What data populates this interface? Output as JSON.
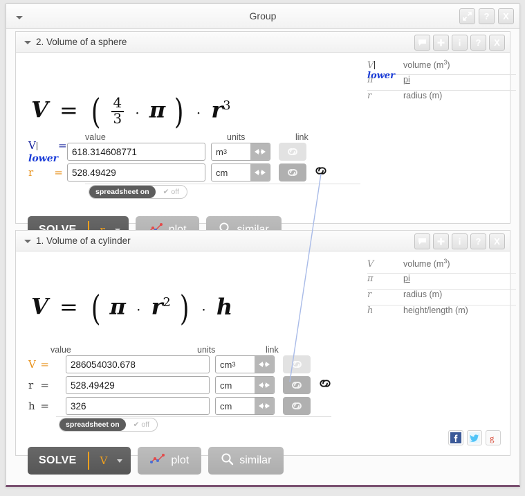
{
  "window": {
    "title": "Group",
    "buttons": [
      {
        "name": "expand-button",
        "icon": "expand-icon"
      },
      {
        "name": "help-button",
        "icon": "question-icon",
        "label": "?"
      },
      {
        "name": "close-button",
        "icon": "close-icon",
        "label": "X"
      }
    ]
  },
  "panel_icons": [
    "comment-icon",
    "plus-icon",
    "info-icon",
    "question-icon",
    "close-icon"
  ],
  "columns": {
    "value": "value",
    "units": "units",
    "link": "link"
  },
  "spreadsheet": {
    "on": "spreadsheet on",
    "off": "off",
    "check": "✔"
  },
  "panels": [
    {
      "id": "sphere",
      "title": "2. Volume of a sphere",
      "equation": {
        "lhs": "V",
        "eq": "=",
        "numerator": "4",
        "denominator": "3",
        "pi": "π",
        "dot": "·",
        "rvar": "r",
        "exponent": "3"
      },
      "variables": [
        {
          "symbol": "V",
          "sub": "lower",
          "editing": true,
          "desc": "volume (m",
          "sup": "3",
          "desc_tail": ")",
          "link": false
        },
        {
          "symbol": "π",
          "desc": "pi",
          "link": true
        },
        {
          "symbol": "r",
          "desc": "radius (m)",
          "link": false
        }
      ],
      "rows": [
        {
          "label": "V",
          "sub": "lower",
          "editing": true,
          "label_color": "blue",
          "eq": "=",
          "value": "618.314608771",
          "units": "m",
          "units_sup": "3",
          "link_active": false,
          "external_link": false
        },
        {
          "label": "r",
          "eq": "=",
          "label_color": "orange",
          "value": "528.49429",
          "units": "cm",
          "units_sup": "",
          "link_active": true,
          "external_link": true
        }
      ],
      "solve": {
        "label": "SOLVE",
        "target": "r"
      },
      "plot": "plot",
      "similar": "similar"
    },
    {
      "id": "cylinder",
      "title": "1. Volume of a cylinder",
      "equation": {
        "lhs": "V",
        "eq": "=",
        "pi": "π",
        "dot": "·",
        "rvar": "r",
        "exponent": "2",
        "hvar": "h"
      },
      "variables": [
        {
          "symbol": "V",
          "desc": "volume (m",
          "sup": "3",
          "desc_tail": ")",
          "link": false
        },
        {
          "symbol": "π",
          "desc": "pi",
          "link": true
        },
        {
          "symbol": "r",
          "desc": "radius (m)",
          "link": false
        },
        {
          "symbol": "h",
          "desc": "height/length (m)",
          "link": false
        }
      ],
      "rows": [
        {
          "label": "V",
          "eq": "=",
          "label_color": "orange",
          "value": "286054030.678",
          "units": "cm",
          "units_sup": "3",
          "link_active": false,
          "external_link": false
        },
        {
          "label": "r",
          "eq": "=",
          "label_color": "dark",
          "value": "528.49429",
          "units": "cm",
          "units_sup": "",
          "link_active": true,
          "external_link": true
        },
        {
          "label": "h",
          "eq": "=",
          "label_color": "dark",
          "value": "326",
          "units": "cm",
          "units_sup": "",
          "link_active": true,
          "external_link": false
        }
      ],
      "solve": {
        "label": "SOLVE",
        "target": "V"
      },
      "plot": "plot",
      "similar": "similar"
    }
  ],
  "social": [
    {
      "name": "facebook-share-button",
      "glyph": "f",
      "color": "#3b5998"
    },
    {
      "name": "twitter-share-button",
      "glyph": "t",
      "color": "#4fc3f7"
    },
    {
      "name": "google-plus-share-button",
      "glyph": "g",
      "color": "#d84a38"
    }
  ],
  "colors": {
    "accent_orange": "#e8911a",
    "accent_blue": "#16229c",
    "edit_blue": "#1a3cd8",
    "connector": "#a9bbe8",
    "window_bottom_border": "#7a5070"
  }
}
